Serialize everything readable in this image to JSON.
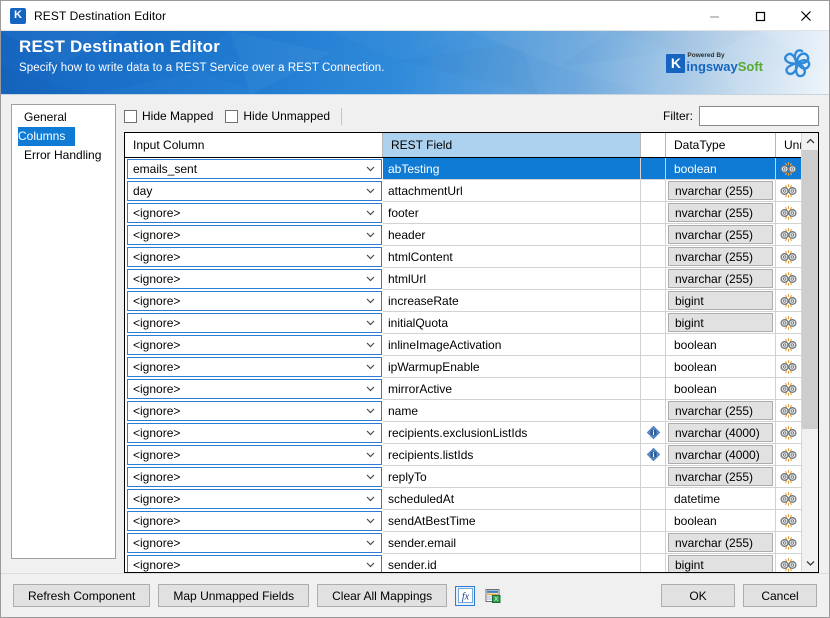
{
  "window": {
    "title": "REST Destination Editor",
    "app_icon": "kingswaysoft-k-icon",
    "controls": {
      "minimize": "minimize-icon",
      "maximize": "maximize-icon",
      "close": "close-icon"
    }
  },
  "banner": {
    "title": "REST Destination Editor",
    "subtitle": "Specify how to write data to a REST Service over a REST Connection.",
    "brand_powered": "Powered By",
    "brand_k": "K",
    "brand_first": "ingsway",
    "brand_second": "Soft",
    "accent_blue": "#1565c0",
    "accent_green": "#5aa833",
    "logo_icon": "pinwheel-logo-icon"
  },
  "sidebar": {
    "items": [
      {
        "label": "General",
        "selected": false
      },
      {
        "label": "Columns",
        "selected": true
      },
      {
        "label": "Error Handling",
        "selected": false
      }
    ],
    "selection_color": "#0f7bd4"
  },
  "toolbar": {
    "hide_mapped_label": "Hide Mapped",
    "hide_mapped_checked": false,
    "hide_unmapped_label": "Hide Unmapped",
    "hide_unmapped_checked": false,
    "filter_label": "Filter:",
    "filter_value": "",
    "filter_placeholder": ""
  },
  "grid": {
    "headers": {
      "input_column": "Input Column",
      "rest_field": "REST Field",
      "data_type": "DataType",
      "unmap": "Unmap"
    },
    "rest_field_header_highlight": "#add2ef",
    "unmap_icon": "broken-link-icon",
    "info_icon": "info-diamond-icon",
    "chevron_icon": "chevron-down-icon",
    "rows": [
      {
        "input": "emails_sent",
        "rest": "abTesting",
        "dtype": "boolean",
        "boxed": false,
        "info": false,
        "selected": true
      },
      {
        "input": "day",
        "rest": "attachmentUrl",
        "dtype": "nvarchar (255)",
        "boxed": true,
        "info": false,
        "selected": false
      },
      {
        "input": "<ignore>",
        "rest": "footer",
        "dtype": "nvarchar (255)",
        "boxed": true,
        "info": false,
        "selected": false
      },
      {
        "input": "<ignore>",
        "rest": "header",
        "dtype": "nvarchar (255)",
        "boxed": true,
        "info": false,
        "selected": false
      },
      {
        "input": "<ignore>",
        "rest": "htmlContent",
        "dtype": "nvarchar (255)",
        "boxed": true,
        "info": false,
        "selected": false
      },
      {
        "input": "<ignore>",
        "rest": "htmlUrl",
        "dtype": "nvarchar (255)",
        "boxed": true,
        "info": false,
        "selected": false
      },
      {
        "input": "<ignore>",
        "rest": "increaseRate",
        "dtype": "bigint",
        "boxed": true,
        "info": false,
        "selected": false
      },
      {
        "input": "<ignore>",
        "rest": "initialQuota",
        "dtype": "bigint",
        "boxed": true,
        "info": false,
        "selected": false
      },
      {
        "input": "<ignore>",
        "rest": "inlineImageActivation",
        "dtype": "boolean",
        "boxed": false,
        "info": false,
        "selected": false
      },
      {
        "input": "<ignore>",
        "rest": "ipWarmupEnable",
        "dtype": "boolean",
        "boxed": false,
        "info": false,
        "selected": false
      },
      {
        "input": "<ignore>",
        "rest": "mirrorActive",
        "dtype": "boolean",
        "boxed": false,
        "info": false,
        "selected": false
      },
      {
        "input": "<ignore>",
        "rest": "name",
        "dtype": "nvarchar (255)",
        "boxed": true,
        "info": false,
        "selected": false
      },
      {
        "input": "<ignore>",
        "rest": "recipients.exclusionListIds",
        "dtype": "nvarchar (4000)",
        "boxed": true,
        "info": true,
        "selected": false
      },
      {
        "input": "<ignore>",
        "rest": "recipients.listIds",
        "dtype": "nvarchar (4000)",
        "boxed": true,
        "info": true,
        "selected": false
      },
      {
        "input": "<ignore>",
        "rest": "replyTo",
        "dtype": "nvarchar (255)",
        "boxed": true,
        "info": false,
        "selected": false
      },
      {
        "input": "<ignore>",
        "rest": "scheduledAt",
        "dtype": "datetime",
        "boxed": false,
        "info": false,
        "selected": false
      },
      {
        "input": "<ignore>",
        "rest": "sendAtBestTime",
        "dtype": "boolean",
        "boxed": false,
        "info": false,
        "selected": false
      },
      {
        "input": "<ignore>",
        "rest": "sender.email",
        "dtype": "nvarchar (255)",
        "boxed": true,
        "info": false,
        "selected": false
      },
      {
        "input": "<ignore>",
        "rest": "sender.id",
        "dtype": "bigint",
        "boxed": true,
        "info": false,
        "selected": false
      }
    ]
  },
  "footer": {
    "refresh_component": "Refresh Component",
    "map_unmapped_fields": "Map Unmapped Fields",
    "clear_all_mappings": "Clear All Mappings",
    "expression_icon": "fx-expression-icon",
    "export_icon": "export-spreadsheet-icon",
    "ok": "OK",
    "cancel": "Cancel"
  }
}
